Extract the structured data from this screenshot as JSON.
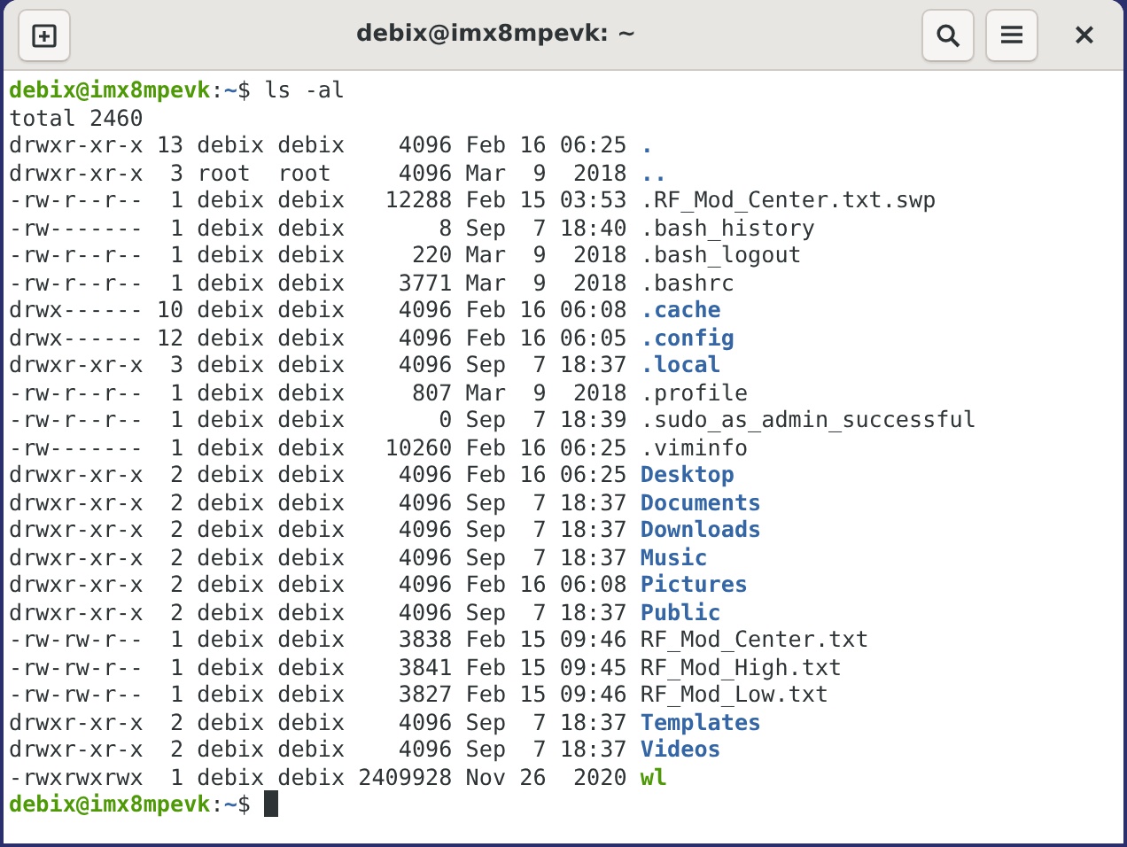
{
  "window": {
    "title": "debix@imx8mpevk: ~"
  },
  "header_buttons": [
    {
      "kind": "new-tab"
    },
    {
      "kind": "search"
    },
    {
      "kind": "menu"
    }
  ],
  "close_button": {
    "label": "×"
  },
  "terminal": {
    "lines": [
      {
        "kind": "prompt",
        "user_host": "debix@imx8mpevk",
        "separator": ":",
        "path": "~",
        "symbol": "$",
        "command": "ls -al"
      },
      {
        "kind": "output",
        "text": "total 2460"
      },
      {
        "kind": "dir",
        "info": "drwxr-xr-x 13 debix debix    4096 Feb 16 06:25",
        "name": "."
      },
      {
        "kind": "dir",
        "info": "drwxr-xr-x  3 root  root     4096 Mar  9  2018",
        "name": ".."
      },
      {
        "kind": "file",
        "info": "-rw-r--r--  1 debix debix   12288 Feb 15 03:53",
        "name": ".RF_Mod_Center.txt.swp"
      },
      {
        "kind": "file",
        "info": "-rw-------  1 debix debix       8 Sep  7 18:40",
        "name": ".bash_history"
      },
      {
        "kind": "file",
        "info": "-rw-r--r--  1 debix debix     220 Mar  9  2018",
        "name": ".bash_logout"
      },
      {
        "kind": "file",
        "info": "-rw-r--r--  1 debix debix    3771 Mar  9  2018",
        "name": ".bashrc"
      },
      {
        "kind": "dir",
        "info": "drwx------ 10 debix debix    4096 Feb 16 06:08",
        "name": ".cache"
      },
      {
        "kind": "dir",
        "info": "drwx------ 12 debix debix    4096 Feb 16 06:05",
        "name": ".config"
      },
      {
        "kind": "dir",
        "info": "drwxr-xr-x  3 debix debix    4096 Sep  7 18:37",
        "name": ".local"
      },
      {
        "kind": "file",
        "info": "-rw-r--r--  1 debix debix     807 Mar  9  2018",
        "name": ".profile"
      },
      {
        "kind": "file",
        "info": "-rw-r--r--  1 debix debix       0 Sep  7 18:39",
        "name": ".sudo_as_admin_successful"
      },
      {
        "kind": "file",
        "info": "-rw-------  1 debix debix   10260 Feb 16 06:25",
        "name": ".viminfo"
      },
      {
        "kind": "dir",
        "info": "drwxr-xr-x  2 debix debix    4096 Feb 16 06:25",
        "name": "Desktop"
      },
      {
        "kind": "dir",
        "info": "drwxr-xr-x  2 debix debix    4096 Sep  7 18:37",
        "name": "Documents"
      },
      {
        "kind": "dir",
        "info": "drwxr-xr-x  2 debix debix    4096 Sep  7 18:37",
        "name": "Downloads"
      },
      {
        "kind": "dir",
        "info": "drwxr-xr-x  2 debix debix    4096 Sep  7 18:37",
        "name": "Music"
      },
      {
        "kind": "dir",
        "info": "drwxr-xr-x  2 debix debix    4096 Feb 16 06:08",
        "name": "Pictures"
      },
      {
        "kind": "dir",
        "info": "drwxr-xr-x  2 debix debix    4096 Sep  7 18:37",
        "name": "Public"
      },
      {
        "kind": "file",
        "info": "-rw-rw-r--  1 debix debix    3838 Feb 15 09:46",
        "name": "RF_Mod_Center.txt"
      },
      {
        "kind": "file",
        "info": "-rw-rw-r--  1 debix debix    3841 Feb 15 09:45",
        "name": "RF_Mod_High.txt"
      },
      {
        "kind": "file",
        "info": "-rw-rw-r--  1 debix debix    3827 Feb 15 09:46",
        "name": "RF_Mod_Low.txt"
      },
      {
        "kind": "dir",
        "info": "drwxr-xr-x  2 debix debix    4096 Sep  7 18:37",
        "name": "Templates"
      },
      {
        "kind": "dir",
        "info": "drwxr-xr-x  2 debix debix    4096 Sep  7 18:37",
        "name": "Videos"
      },
      {
        "kind": "exec",
        "info": "-rwxrwxrwx  1 debix debix 2409928 Nov 26  2020",
        "name": "wl"
      },
      {
        "kind": "prompt",
        "user_host": "debix@imx8mpevk",
        "separator": ":",
        "path": "~",
        "symbol": "$",
        "cursor": true
      }
    ]
  }
}
